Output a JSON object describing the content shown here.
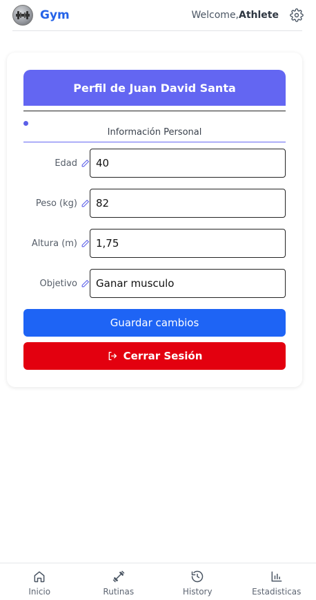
{
  "header": {
    "brand": "Gym",
    "welcome_prefix": "Welcome,",
    "welcome_user": "Athlete"
  },
  "profile": {
    "title": "Perfil de Juan David Santa",
    "section": "Información Personal",
    "fields": [
      {
        "label": "Edad",
        "value": "40"
      },
      {
        "label": "Peso (kg)",
        "value": "82"
      },
      {
        "label": "Altura (m)",
        "value": "1,75"
      },
      {
        "label": "Objetivo",
        "value": "Ganar musculo"
      }
    ],
    "save_label": "Guardar cambios",
    "logout_label": "Cerrar Sesión"
  },
  "nav": {
    "items": [
      {
        "label": "Inicio",
        "icon": "home-icon"
      },
      {
        "label": "Rutinas",
        "icon": "dumbbell-icon"
      },
      {
        "label": "History",
        "icon": "history-icon"
      },
      {
        "label": "Estadisticas",
        "icon": "bar-chart-icon"
      }
    ]
  },
  "colors": {
    "brand": "#2563e8",
    "header_card": "#6366f2",
    "save_button": "#1e64f5",
    "logout_button": "#e3000f"
  }
}
